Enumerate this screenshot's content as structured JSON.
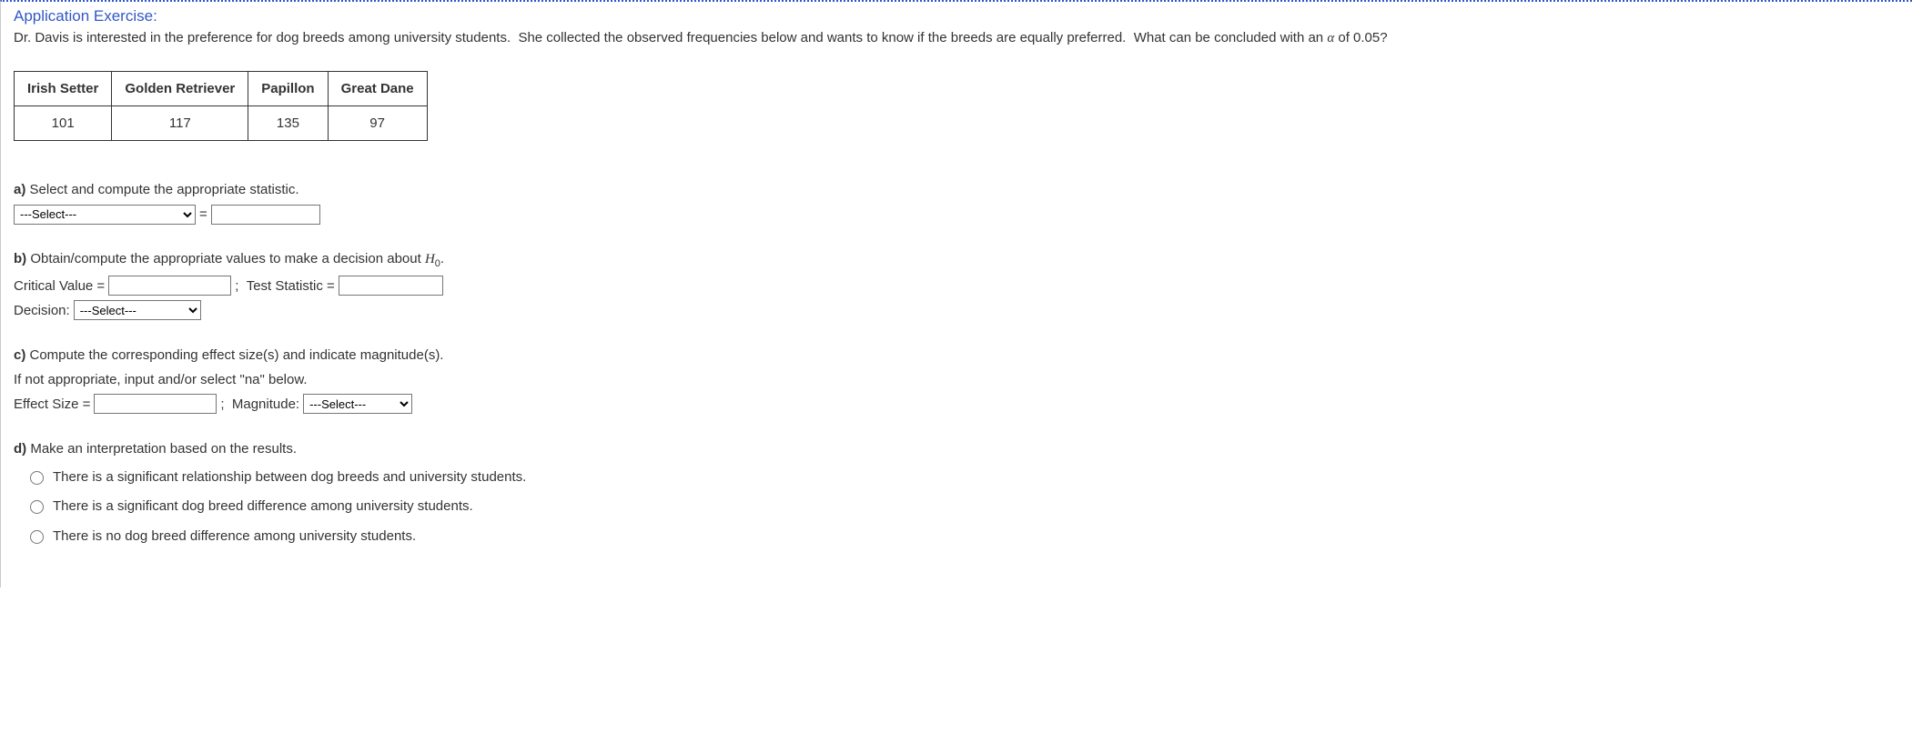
{
  "title": "Application Exercise:",
  "intro_part1": "Dr. Davis is interested in the preference for dog breeds among university students.  She collected the observed frequencies below and wants to know if the breeds are equally preferred.  What can be concluded with an ",
  "intro_alpha": "α",
  "intro_part2": " of 0.05?",
  "table": {
    "headers": [
      "Irish Setter",
      "Golden Retriever",
      "Papillon",
      "Great Dane"
    ],
    "values": [
      "101",
      "117",
      "135",
      "97"
    ]
  },
  "parts": {
    "a": {
      "label": "a)",
      "text": " Select and compute the appropriate statistic.",
      "select_placeholder": "---Select---",
      "equals": " = "
    },
    "b": {
      "label": "b)",
      "text": " Obtain/compute the appropriate values to make a decision about ",
      "h0": "H",
      "h0_sub": "0",
      "period": ".",
      "critical_label": "Critical Value = ",
      "sep": " ;  Test Statistic = ",
      "decision_label": "Decision: ",
      "select_placeholder": "---Select---"
    },
    "c": {
      "label": "c)",
      "text": " Compute the corresponding effect size(s) and indicate magnitude(s).",
      "hint": "If not appropriate, input and/or select \"na\" below.",
      "effect_label": "Effect Size = ",
      "sep": " ;  Magnitude: ",
      "select_placeholder": "---Select---"
    },
    "d": {
      "label": "d)",
      "text": " Make an interpretation based on the results.",
      "options": [
        "There is a significant relationship between dog breeds and university students.",
        "There is a significant dog breed difference among university students.",
        "There is no dog breed difference among university students."
      ]
    }
  }
}
